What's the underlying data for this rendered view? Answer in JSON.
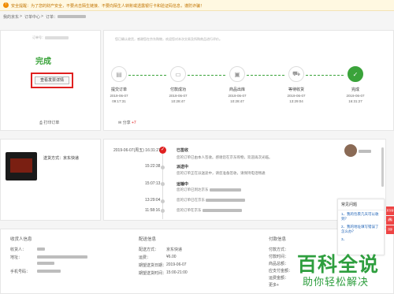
{
  "notice_bar": {
    "icon": "warning-icon",
    "text": "安全提醒：为了您的财产安全，不要点击陌生链接、不要向陌生人转账或透露银行卡和验证码信息，谨防诈骗！"
  },
  "breadcrumb": {
    "home": "我的京东",
    "sep1": ">",
    "orders": "订单中心",
    "sep2": ">",
    "order_label": "订单："
  },
  "summary": {
    "order_no_label": "订单号：",
    "status": "完成",
    "invoice_button": "查看发票详情",
    "print_label": "打印订单"
  },
  "progress": {
    "notice": "您已确认收货，感谢您在京东购物，欢迎您对本次交易及所购商品进行评价。",
    "steps": [
      {
        "label": "提交订单",
        "date": "2019-06-07",
        "time": "09:17:31",
        "icon": "clipboard-icon"
      },
      {
        "label": "付款成功",
        "date": "2019-06-07",
        "time": "10:28:47",
        "icon": "card-icon"
      },
      {
        "label": "商品出库",
        "date": "2019-06-07",
        "time": "10:28:47",
        "icon": "box-icon"
      },
      {
        "label": "等待收货",
        "date": "2019-06-07",
        "time": "13:29:04",
        "icon": "truck-icon"
      },
      {
        "label": "完成",
        "date": "2019-06-07",
        "time": "16:31:27",
        "icon": "check-icon"
      }
    ],
    "share_label": "分享",
    "share_count": "+7"
  },
  "shipping": {
    "method": "送货方式：京东快递",
    "tracking": [
      {
        "time": "2019-06-07(周五)  16:31:27",
        "title": "已签收",
        "desc": "您的订单已由本人签收。感谢您在京东购物，欢迎再次光临。"
      },
      {
        "time": "15:22:38",
        "title": "派送中",
        "desc": "您的订单正在派送途中，请您准备签收，请保持电话畅通"
      },
      {
        "time": "15:07:13",
        "title": "运输中",
        "desc": "您的订单已到达京东"
      },
      {
        "time": "13:29:04",
        "title": "",
        "desc": "您的订单已在京东"
      },
      {
        "time": "11:58:16",
        "title": "",
        "desc": "您的订单在京东"
      }
    ]
  },
  "receiver": {
    "heading": "收货人信息",
    "name_label": "收货人：",
    "address_label": "地址：",
    "phone_label": "手机号码："
  },
  "delivery": {
    "heading": "配送信息",
    "method_label": "配送方式：",
    "method_value": "京东快递",
    "fee_label": "运费：",
    "fee_value": "¥6.00",
    "date_label": "期望送货日期：",
    "date_value": "2019-06-07",
    "time_label": "期望送货时间：",
    "time_value": "15:00-21:00"
  },
  "payment": {
    "heading": "付款信息",
    "rows": [
      "付款方式：",
      "付款时间：",
      "商品总额：",
      "应支付金额：",
      "运费金额：",
      "更多+"
    ]
  },
  "chat": {
    "title": "常见问题",
    "q1": "1、我的包裹几天可以收到？",
    "q2": "2、我的地址填写错误了怎么办？",
    "q3": "3、"
  },
  "rightbar": [
    "京东客服",
    "反馈",
    "顶部"
  ],
  "watermark": {
    "line1": "百科全说",
    "line2": "助你轻松解决"
  }
}
